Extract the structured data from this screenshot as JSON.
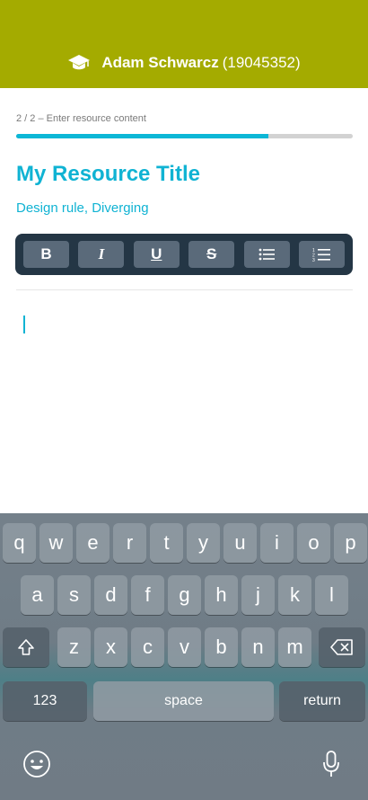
{
  "header": {
    "icon": "graduation-cap-icon",
    "user_name": "Adam Schwarcz",
    "user_id": "(19045352)",
    "background": "#a4ab00"
  },
  "progress": {
    "step_label": "2 / 2  –  Enter resource content",
    "fraction": 0.75,
    "color": "#0cb7d6"
  },
  "resource": {
    "title": "My Resource Title",
    "tags": "Design rule, Diverging",
    "accent": "#10b3d3"
  },
  "toolbar": {
    "bold": "B",
    "italic": "I",
    "underline": "U",
    "strikethrough": "S",
    "bullet_list_icon": "bullet-list-icon",
    "numbered_list_icon": "numbered-list-icon",
    "background": "#243645"
  },
  "editor": {
    "content": ""
  },
  "keyboard": {
    "row1": [
      "q",
      "w",
      "e",
      "r",
      "t",
      "y",
      "u",
      "i",
      "o",
      "p"
    ],
    "row2": [
      "a",
      "s",
      "d",
      "f",
      "g",
      "h",
      "j",
      "k",
      "l"
    ],
    "row3": [
      "z",
      "x",
      "c",
      "v",
      "b",
      "n",
      "m"
    ],
    "numbers_label": "123",
    "space_label": "space",
    "return_label": "return",
    "shift_icon": "shift-icon",
    "backspace_icon": "backspace-icon",
    "emoji_icon": "emoji-icon",
    "mic_icon": "microphone-icon"
  }
}
